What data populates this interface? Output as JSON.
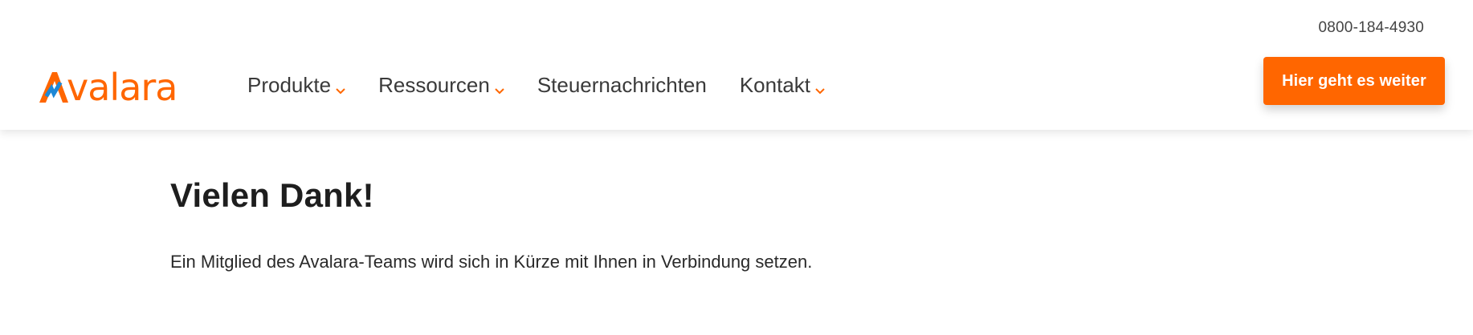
{
  "header": {
    "phone": "0800-184-4930",
    "logo_text": "Avalara",
    "nav": [
      {
        "label": "Produkte",
        "has_dropdown": true
      },
      {
        "label": "Ressourcen",
        "has_dropdown": true
      },
      {
        "label": "Steuernachrichten",
        "has_dropdown": false
      },
      {
        "label": "Kontakt",
        "has_dropdown": true
      }
    ],
    "cta_label": "Hier geht es weiter"
  },
  "main": {
    "title": "Vielen Dank!",
    "message": "Ein Mitglied des Avalara-Teams wird sich in Kürze mit Ihnen in Verbindung setzen."
  },
  "colors": {
    "brand_orange": "#ff6600",
    "logo_blue": "#1e88d6",
    "text_dark": "#1e1e1e",
    "nav_text": "#3a3a3a"
  }
}
